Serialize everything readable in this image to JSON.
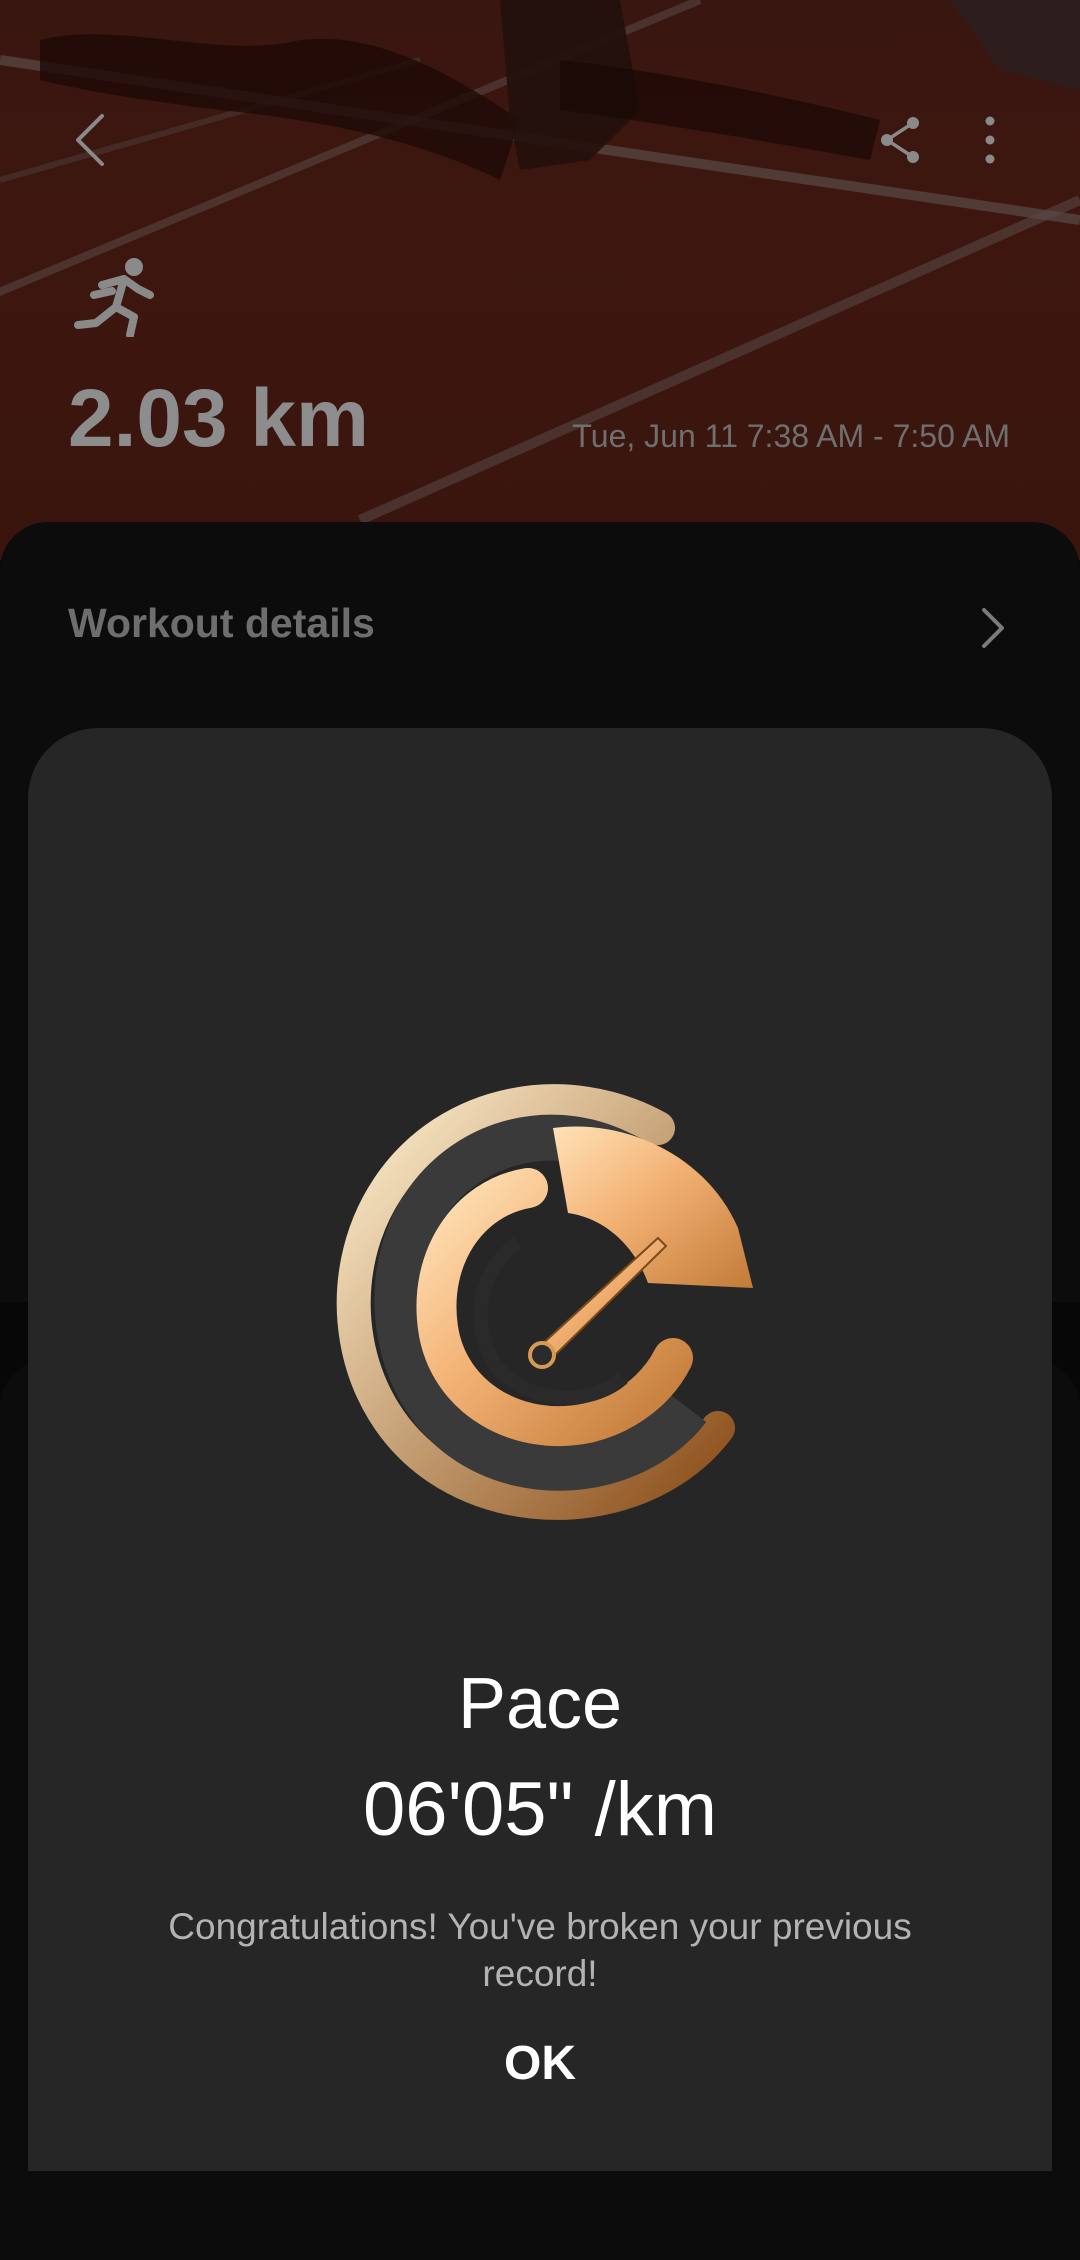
{
  "header": {
    "back_icon": "chevron-left-icon",
    "share_icon": "share-icon",
    "more_icon": "more-vertical-icon"
  },
  "summary": {
    "activity_icon": "running-icon",
    "distance": "2.03 km",
    "date_range": "Tue, Jun 11 7:38 AM - 7:50 AM"
  },
  "workout_details": {
    "label": "Workout details",
    "chevron_icon": "chevron-right-icon"
  },
  "dialog": {
    "badge_icon": "speedometer-medal-icon",
    "title": "Pace",
    "value": "06'05\" /km",
    "message": "Congratulations! You've broken your previous record!",
    "ok_label": "OK"
  },
  "colors": {
    "track": "#3d170f",
    "dialog_bg": "#262626",
    "medal_gold": "#f0b070"
  }
}
